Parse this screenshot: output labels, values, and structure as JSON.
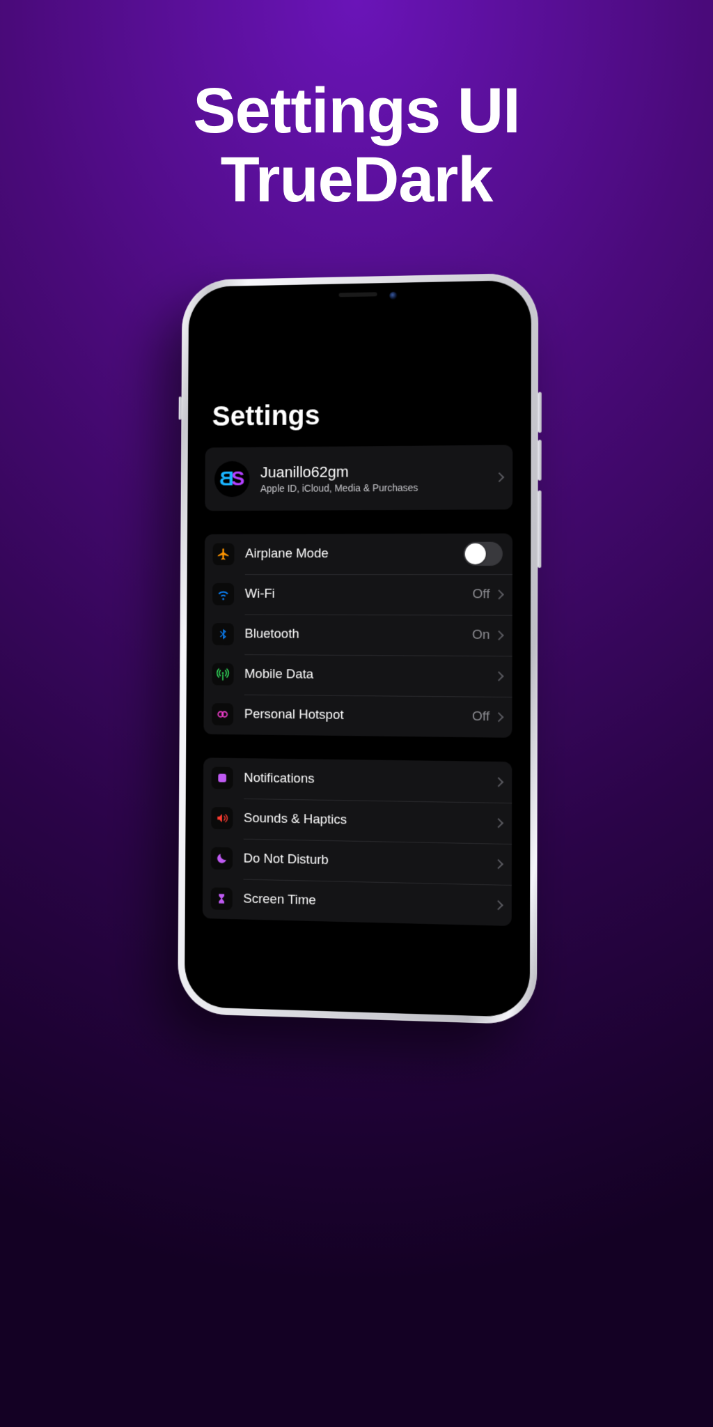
{
  "headline_line1": "Settings UI",
  "headline_line2": "TrueDark",
  "screen_title": "Settings",
  "profile": {
    "name": "Juanillo62gm",
    "subtitle": "Apple ID, iCloud, Media & Purchases"
  },
  "group_connectivity": [
    {
      "icon": "airplane",
      "label": "Airplane Mode",
      "kind": "toggle",
      "value": "off"
    },
    {
      "icon": "wifi",
      "label": "Wi-Fi",
      "kind": "detail",
      "value": "Off"
    },
    {
      "icon": "bluetooth",
      "label": "Bluetooth",
      "kind": "detail",
      "value": "On"
    },
    {
      "icon": "antenna",
      "label": "Mobile Data",
      "kind": "detail",
      "value": ""
    },
    {
      "icon": "hotspot",
      "label": "Personal Hotspot",
      "kind": "detail",
      "value": "Off"
    }
  ],
  "group_system": [
    {
      "icon": "bell",
      "label": "Notifications"
    },
    {
      "icon": "sound",
      "label": "Sounds & Haptics"
    },
    {
      "icon": "moon",
      "label": "Do Not Disturb"
    },
    {
      "icon": "hourglass",
      "label": "Screen Time"
    }
  ]
}
